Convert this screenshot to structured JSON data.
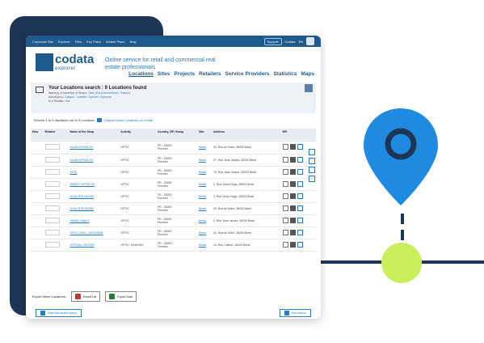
{
  "topbar": {
    "nav": [
      "Corporate Site",
      "Explorer",
      "Files",
      "Key Plans",
      "Market Place",
      "Blog"
    ],
    "support_label": "Support",
    "user_label": "Codata",
    "lang_label": "EN"
  },
  "brand": {
    "name": "codata",
    "sub": "explorer",
    "tagline": "Online service for retail and commercial real estate professionals"
  },
  "mainnav": [
    "Locations",
    "Sites",
    "Projects",
    "Retailers",
    "Service Providers",
    "Statistics",
    "Maps"
  ],
  "search": {
    "title": "Your Locations search : 9 Locations found",
    "lines": [
      {
        "k": "Name(s) of parent(s) of Shops:",
        "v": "Town (Est d'Armentieres, France)"
      },
      {
        "k": "Activity(ies):",
        "v": "Optique, Lunettes, Opticien, Eyewear"
      },
      {
        "k": "Is a Retailer:",
        "v": "Yes"
      }
    ]
  },
  "results": {
    "text": "Results 1 to 9 displayed out of 9 Locations",
    "map_link": "Display these Locations on a Map"
  },
  "table": {
    "headers": [
      "New",
      "Retailer",
      "Name of the Shop",
      "Activity",
      "Country, ZIP, Group",
      "Site",
      "Address",
      "",
      "MR"
    ],
    "rows": [
      {
        "name": "ALAIN AFFLELOU",
        "activity": "OPTIC",
        "zip": "FR - 28200",
        "city": "Frechen",
        "site": "Bresil",
        "address": "04, Rue de Saint, 28200 Brest"
      },
      {
        "name": "ALAIN AFFLELOU",
        "activity": "OPTIC",
        "zip": "FR - 28200",
        "city": "Frechen",
        "site": "Bresil",
        "address": "07, Rue Jean Jaurès, 28200 Brest"
      },
      {
        "name": "ATOL",
        "activity": "OPTIC",
        "zip": "FR - 28200",
        "city": "Frechen",
        "site": "Bresil",
        "address": "70, Rue Jean Jaurès, 28200 Brest"
      },
      {
        "name": "DIRECT OPTIC CE",
        "activity": "OPTIC",
        "zip": "FR - 28200",
        "city": "Frechen",
        "site": "Bresil",
        "address": "2, Rue Victor Hugo, 28200 Brest"
      },
      {
        "name": "GOULTER VISION",
        "activity": "OPTIC",
        "zip": "FR - 28200",
        "city": "Frechen",
        "site": "Bresil",
        "address": "3, Rue Victor Hugo, 28200 Brest"
      },
      {
        "name": "GOULTER VISION",
        "activity": "OPTIC",
        "zip": "FR - 28200",
        "city": "Frechen",
        "site": "Bresil",
        "address": "03, Rue de Saint, 28200 Brest"
      },
      {
        "name": "KRANY SHALY",
        "activity": "OPTIC",
        "zip": "FR - 28200",
        "city": "Frechen",
        "site": "Bresil",
        "address": "2, Rue Jean Jaurès, 28200 Brest"
      },
      {
        "name": "OPTIC 2000 - DISCOBEN",
        "activity": "OPTIC",
        "zip": "FR - 28200",
        "city": "Frechen",
        "site": "Bresil",
        "address": "02, Rue de Saint, 28200 Brest"
      },
      {
        "name": "OPTICAL CENTER",
        "activity": "OPTIC, HEARING",
        "zip": "FR - 28200",
        "city": "Frechen",
        "site": "Bresil",
        "address": "14, Rue Colbert, 28200 Brest"
      }
    ]
  },
  "export": {
    "label": "Export these Locations:",
    "list_label": "Export List",
    "data_label": "Export Data"
  },
  "footer": {
    "save_label": "Save this search query",
    "new_label": "New search"
  }
}
